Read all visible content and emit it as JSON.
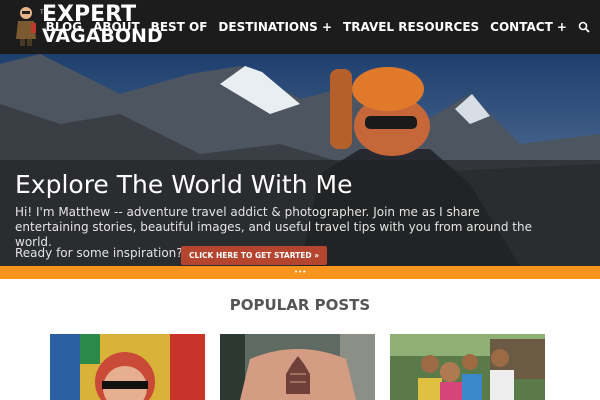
{
  "header": {
    "logo": {
      "line_small": "The",
      "line1": "EXPERT",
      "line2": "VAGABOND"
    },
    "nav": [
      {
        "label": "BLOG"
      },
      {
        "label": "ABOUT"
      },
      {
        "label": "BEST OF"
      },
      {
        "label": "DESTINATIONS +"
      },
      {
        "label": "TRAVEL RESOURCES"
      },
      {
        "label": "CONTACT +"
      }
    ],
    "search_icon": "search-icon"
  },
  "hero": {
    "title": "Explore The World With Me",
    "text": "Hi! I'm Matthew -- adventure travel addict & photographer. Join me as I share entertaining stories, beautiful images, and useful travel tips with you from around the world.",
    "cta_prompt": "Ready for some inspiration?",
    "cta_button": "CLICK HERE TO GET STARTED »"
  },
  "slider_dots": "•••",
  "popular": {
    "title": "POPULAR POSTS"
  },
  "colors": {
    "header_bg": "#1c1c1c",
    "accent_orange": "#f7941d",
    "cta_red": "#b5452e"
  }
}
